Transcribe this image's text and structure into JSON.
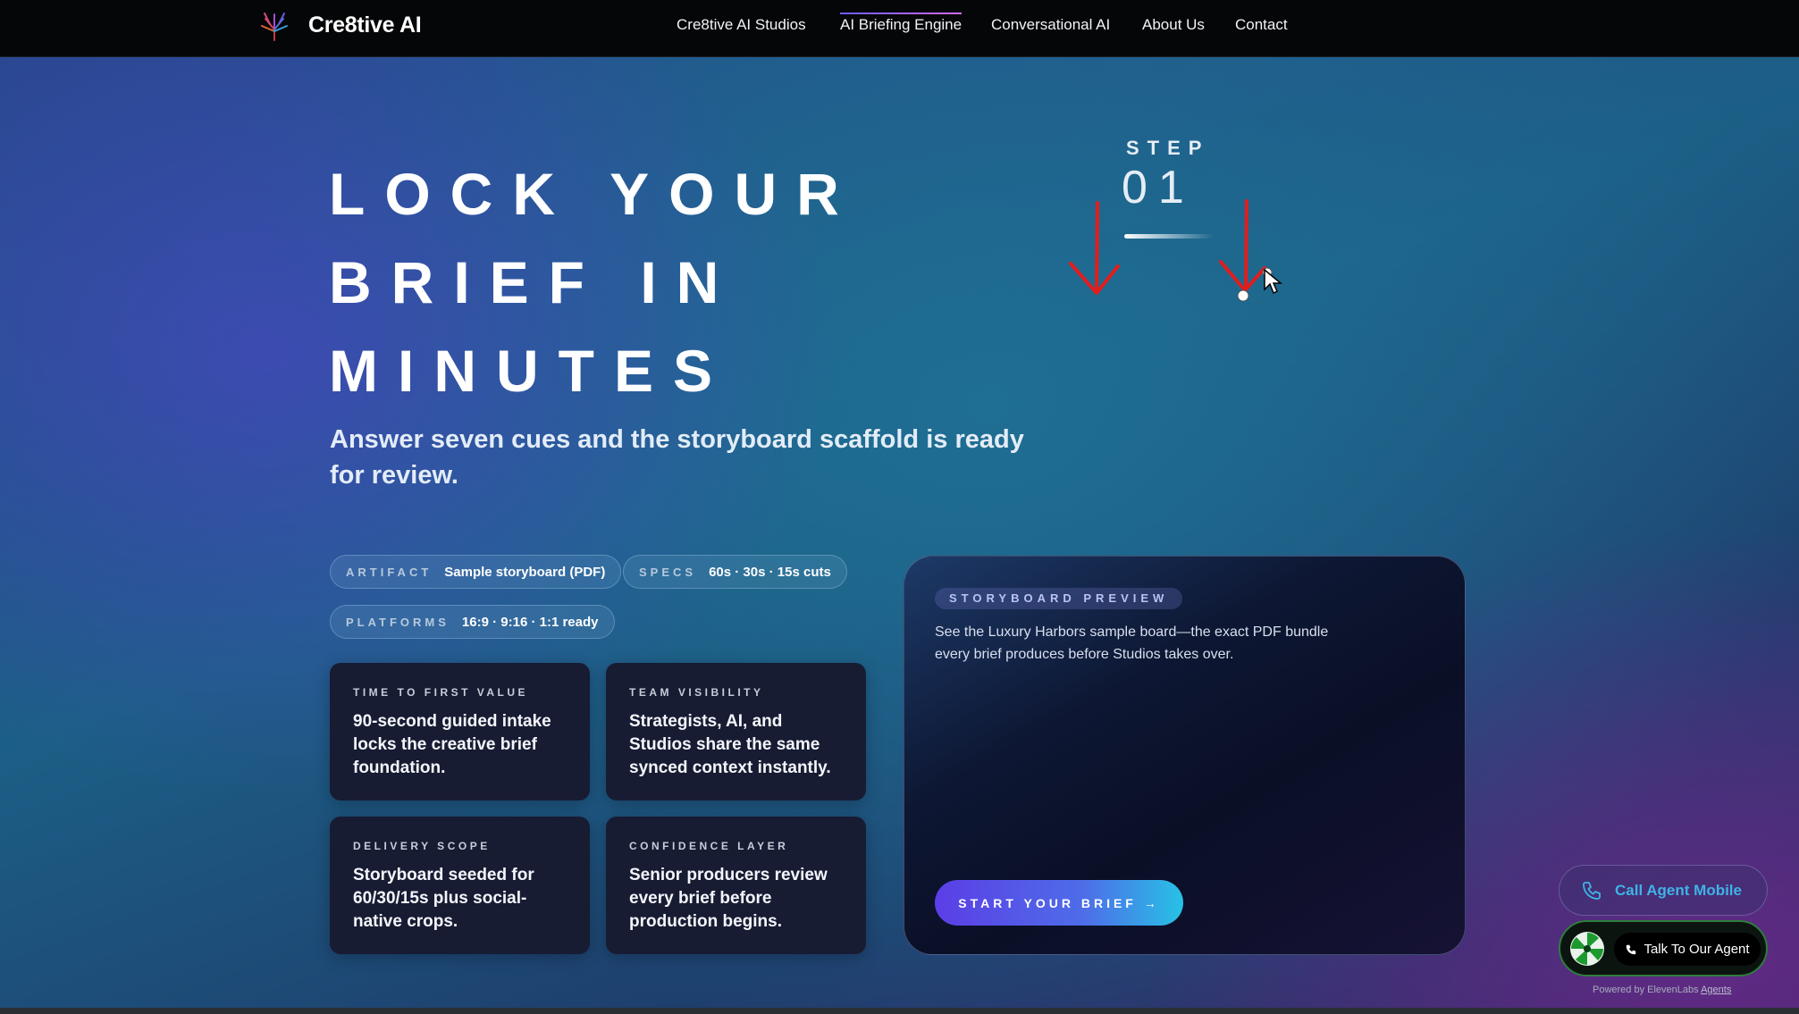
{
  "nav": {
    "brand": "Cre8tive AI",
    "links": [
      {
        "label": "Cre8tive AI Studios"
      },
      {
        "label": "AI Briefing Engine",
        "active": true
      },
      {
        "label": "Conversational AI"
      },
      {
        "label": "About Us"
      },
      {
        "label": "Contact"
      }
    ],
    "logo_icon": "tree-logo-icon"
  },
  "hero": {
    "title_lines": [
      "LOCK YOUR",
      "BRIEF IN",
      "MINUTES"
    ],
    "subtitle": "Answer seven cues and the storyboard scaffold is ready for review."
  },
  "step": {
    "label": "STEP",
    "number": "01"
  },
  "pills": [
    {
      "key": "ARTIFACT",
      "value": "Sample storyboard (PDF)"
    },
    {
      "key": "SPECS",
      "value": "60s · 30s · 15s cuts"
    },
    {
      "key": "PLATFORMS",
      "value": "16:9 · 9:16 · 1:1 ready"
    }
  ],
  "cards": [
    {
      "kicker": "TIME TO FIRST VALUE",
      "body": "90-second guided intake locks the creative brief foundation."
    },
    {
      "kicker": "TEAM VISIBILITY",
      "body": "Strategists, AI, and Studios share the same synced context instantly."
    },
    {
      "kicker": "DELIVERY SCOPE",
      "body": "Storyboard seeded for 60/30/15s plus social-native crops."
    },
    {
      "kicker": "CONFIDENCE LAYER",
      "body": "Senior producers review every brief before production begins."
    }
  ],
  "preview": {
    "tag": "STORYBOARD PREVIEW",
    "text": "See the Luxury Harbors sample board—the exact PDF bundle every brief produces before Studios takes over.",
    "cta": "START YOUR BRIEF →"
  },
  "widgets": {
    "call_mobile": "Call Agent Mobile",
    "talk_agent": "Talk To Our Agent",
    "powered_prefix": "Powered by ElevenLabs ",
    "powered_link": "Agents"
  },
  "colors": {
    "accent_purple": "#5b3ee6",
    "accent_cyan": "#27c2e6",
    "call_blue": "#3fb3e6",
    "agent_green": "#2e7d3d",
    "annotation_red": "#e11d1d"
  }
}
